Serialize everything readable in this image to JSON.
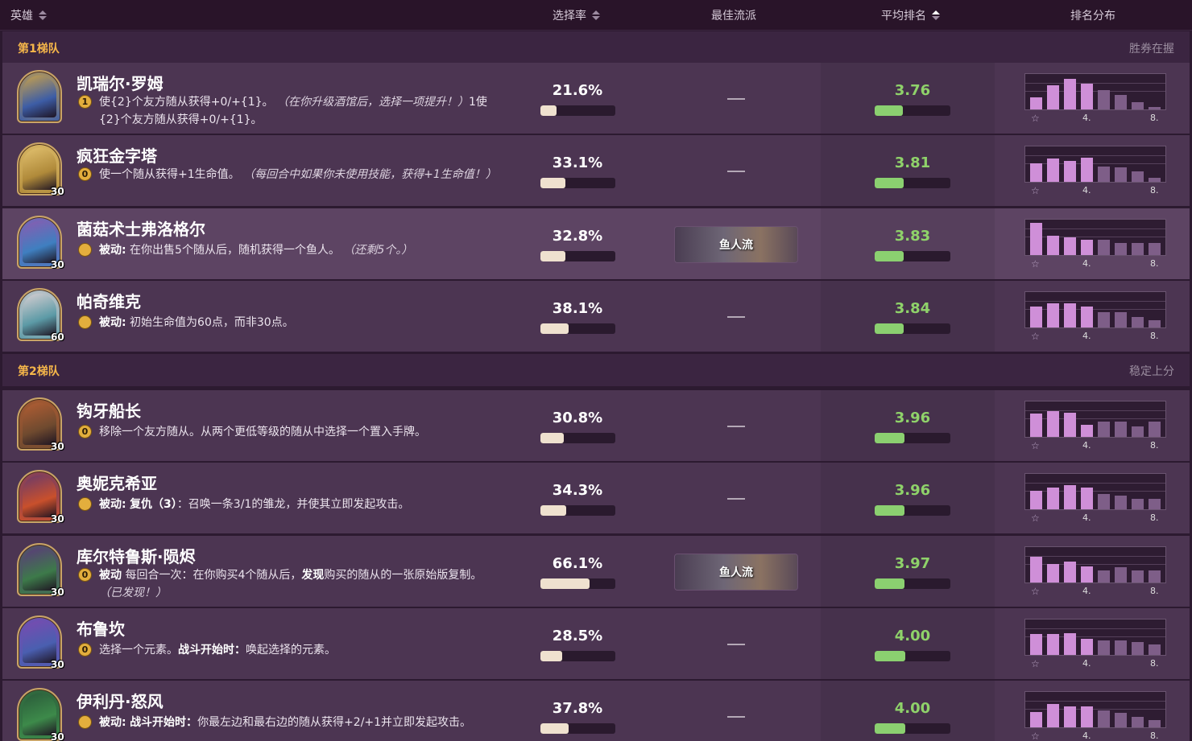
{
  "header": {
    "hero": "英雄",
    "pick_rate": "选择率",
    "best_comp": "最佳流派",
    "avg_rank": "平均排名",
    "rank_dist": "排名分布"
  },
  "tiers": [
    {
      "name": "第1梯队",
      "desc": "胜券在握",
      "heroes": [
        {
          "name": "凯瑞尔·罗姆",
          "coin": "1",
          "armor": "",
          "desc_html": "使{2}个友方随从获得+0/+{1}。 <i>（在你升级酒馆后，选择一项提升！）</i>1使{2}个友方随从获得+0/+{1}。",
          "pick_pct": "21.6%",
          "pick_frac": 0.216,
          "comp": "",
          "avg_rank": "3.76",
          "rank_value": 3.76,
          "dist": [
            0.35,
            0.72,
            0.9,
            0.75,
            0.58,
            0.42,
            0.22,
            0.08
          ],
          "hl": false,
          "colors": [
            "#3d5da6",
            "#c9a14a"
          ]
        },
        {
          "name": "疯狂金字塔",
          "coin": "0",
          "armor": "30",
          "desc_html": "使一个随从获得+1生命值。 <i>（每回合中如果你未使用技能，获得+1生命值！）</i>",
          "pick_pct": "33.1%",
          "pick_frac": 0.331,
          "comp": "",
          "avg_rank": "3.81",
          "rank_value": 3.81,
          "dist": [
            0.55,
            0.68,
            0.62,
            0.72,
            0.45,
            0.42,
            0.32,
            0.12
          ],
          "hl": false,
          "colors": [
            "#b08a3a",
            "#e2c16f"
          ]
        },
        {
          "name": "菌菇术士弗洛格尔",
          "coin": "",
          "armor": "30",
          "desc_html": "<b>被动:</b> 在你出售5个随从后，随机获得一个鱼人。 <i>（还剩5个。）</i>",
          "pick_pct": "32.8%",
          "pick_frac": 0.328,
          "comp": "鱼人流",
          "avg_rank": "3.83",
          "rank_value": 3.83,
          "dist": [
            0.95,
            0.58,
            0.52,
            0.45,
            0.45,
            0.35,
            0.35,
            0.35
          ],
          "hl": true,
          "colors": [
            "#3f7fc0",
            "#8a5bb0"
          ]
        },
        {
          "name": "帕奇维克",
          "coin": "",
          "armor": "60",
          "desc_html": "<b>被动:</b> 初始生命值为60点，而非30点。",
          "pick_pct": "38.1%",
          "pick_frac": 0.381,
          "comp": "",
          "avg_rank": "3.84",
          "rank_value": 3.84,
          "dist": [
            0.62,
            0.72,
            0.72,
            0.62,
            0.45,
            0.45,
            0.32,
            0.22
          ],
          "hl": false,
          "colors": [
            "#5c9aa6",
            "#d9cfd2"
          ]
        }
      ]
    },
    {
      "name": "第2梯队",
      "desc": "稳定上分",
      "heroes": [
        {
          "name": "钩牙船长",
          "coin": "0",
          "armor": "30",
          "desc_html": "移除一个友方随从。从两个更低等级的随从中选择一个置入手牌。",
          "pick_pct": "30.8%",
          "pick_frac": 0.308,
          "comp": "",
          "avg_rank": "3.96",
          "rank_value": 3.96,
          "dist": [
            0.68,
            0.75,
            0.72,
            0.35,
            0.45,
            0.45,
            0.32,
            0.45
          ],
          "hl": false,
          "colors": [
            "#6f4a2f",
            "#b25e34"
          ]
        },
        {
          "name": "奥妮克希亚",
          "coin": "",
          "armor": "30",
          "desc_html": "<b>被动:</b> <b>复仇（3）</b>：召唤一条3/1的雏龙，并使其立即发起攻击。",
          "pick_pct": "34.3%",
          "pick_frac": 0.343,
          "comp": "",
          "avg_rank": "3.96",
          "rank_value": 3.96,
          "dist": [
            0.55,
            0.65,
            0.72,
            0.65,
            0.45,
            0.4,
            0.32,
            0.32
          ],
          "hl": false,
          "colors": [
            "#c9502c",
            "#6a3a6a"
          ]
        },
        {
          "name": "库尔特鲁斯·陨烬",
          "coin": "0",
          "armor": "30",
          "desc_html": "<b>被动</b> 每回合一次：在你购买4个随从后，<b>发现</b>购买的随从的一张原始版复制。 <i>（已发现！）</i>",
          "pick_pct": "66.1%",
          "pick_frac": 0.661,
          "comp": "鱼人流",
          "avg_rank": "3.97",
          "rank_value": 3.97,
          "dist": [
            0.75,
            0.55,
            0.62,
            0.48,
            0.35,
            0.45,
            0.35,
            0.35
          ],
          "hl": false,
          "colors": [
            "#3d7a4a",
            "#5b3a7a"
          ]
        },
        {
          "name": "布鲁坎",
          "coin": "0",
          "armor": "30",
          "desc_html": "选择一个元素。<b>战斗开始时：</b>唤起选择的元素。",
          "pick_pct": "28.5%",
          "pick_frac": 0.285,
          "comp": "",
          "avg_rank": "4.00",
          "rank_value": 4.0,
          "dist": [
            0.62,
            0.62,
            0.65,
            0.48,
            0.42,
            0.42,
            0.38,
            0.32
          ],
          "hl": false,
          "colors": [
            "#4a5fb0",
            "#7a4ab0"
          ]
        },
        {
          "name": "伊利丹·怒风",
          "coin": "",
          "armor": "30",
          "desc_html": "<b>被动:</b> <b>战斗开始时：</b>你最左边和最右边的随从获得+2/+1并立即发起攻击。",
          "pick_pct": "37.8%",
          "pick_frac": 0.378,
          "comp": "",
          "avg_rank": "4.00",
          "rank_value": 4.0,
          "dist": [
            0.45,
            0.68,
            0.62,
            0.62,
            0.5,
            0.42,
            0.32,
            0.22
          ],
          "hl": false,
          "colors": [
            "#3d8a4a",
            "#2a5a3a"
          ]
        }
      ]
    }
  ],
  "dist_labels": {
    "star": "☆",
    "l4": "4.",
    "l8": "8."
  },
  "rank_scale_max": 8,
  "colors": {
    "accent_gold": "#f5b64a",
    "rank_green": "#8fd26a",
    "pick_fill": "#efe1cf",
    "dist_bar": "#cf8fd8",
    "dist_bar_low": "#7e5e88"
  }
}
